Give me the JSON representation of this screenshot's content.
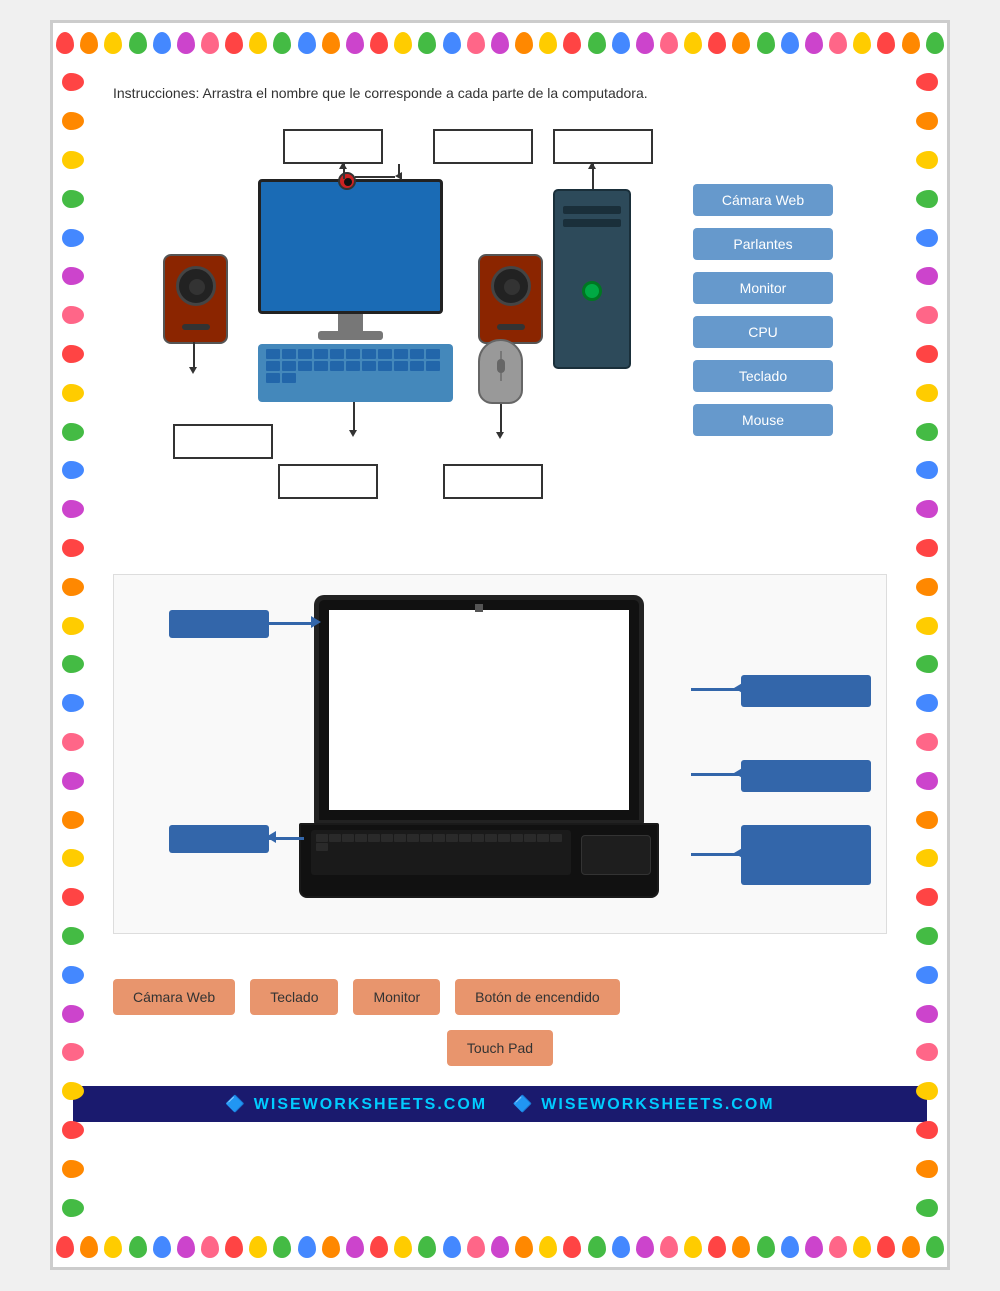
{
  "page": {
    "background": "white"
  },
  "instructions": {
    "text": "Instrucciones: Arrastra el nombre que le corresponde a cada parte de la computadora."
  },
  "section1": {
    "answer_buttons": [
      {
        "id": "camara-web",
        "label": "Cámara Web"
      },
      {
        "id": "parlantes",
        "label": "Parlantes"
      },
      {
        "id": "monitor",
        "label": "Monitor"
      },
      {
        "id": "cpu",
        "label": "CPU"
      },
      {
        "id": "teclado",
        "label": "Teclado"
      },
      {
        "id": "mouse",
        "label": "Mouse"
      }
    ]
  },
  "section3": {
    "answer_buttons": [
      {
        "id": "camara-web-2",
        "label": "Cámara Web"
      },
      {
        "id": "teclado-2",
        "label": "Teclado"
      },
      {
        "id": "monitor-2",
        "label": "Monitor"
      },
      {
        "id": "boton-encendido",
        "label": "Botón de encendido"
      },
      {
        "id": "touch-pad",
        "label": "Touch Pad"
      }
    ]
  },
  "footer": {
    "text_left": "WISEWORKSHEETS.COM",
    "text_right": "WISEWORKSHEETS.COM"
  },
  "balloon_colors": [
    "#ff4444",
    "#ff8800",
    "#ffcc00",
    "#44bb44",
    "#4488ff",
    "#cc44cc",
    "#ff6688",
    "#44cccc"
  ]
}
